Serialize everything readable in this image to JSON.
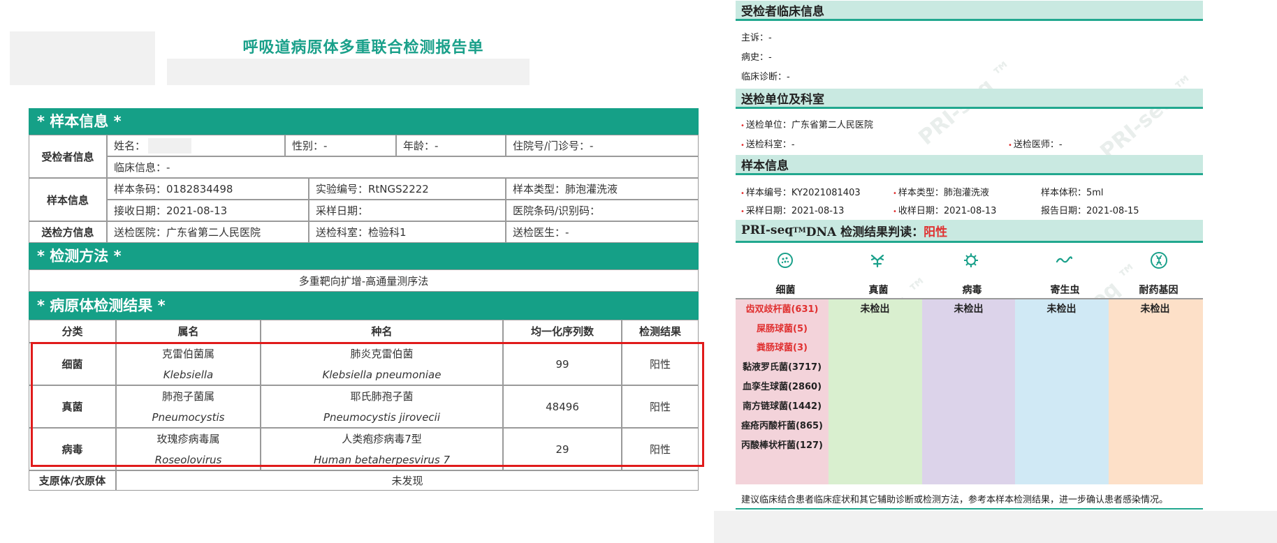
{
  "report": {
    "title": "呼吸道病原体多重联合检测报告单",
    "sections": {
      "sample_info": "* 样本信息 *",
      "method": "* 检测方法 *",
      "results": "* 病原体检测结果 *"
    },
    "patient": {
      "group_label": "受检者信息",
      "name_label": "姓名：",
      "gender": "性别：-",
      "age": "年龄：-",
      "hospital_no": "住院号/门诊号：-",
      "clinical": "临床信息：-"
    },
    "sample": {
      "group_label": "样本信息",
      "barcode": "样本条码：0182834498",
      "lab_no": "实验编号：RtNGS2222",
      "type": "样本类型：肺泡灌洗液",
      "received": "接收日期：2021-08-13",
      "collected": "采样日期：",
      "hospital_barcode": "医院条码/识别码："
    },
    "sender": {
      "group_label": "送检方信息",
      "hospital": "送检医院：广东省第二人民医院",
      "dept": "送检科室：检验科1",
      "doctor": "送检医生：-"
    },
    "method_text": "多重靶向扩增-高通量测序法",
    "results_table": {
      "headers": [
        "分类",
        "属名",
        "种名",
        "均一化序列数",
        "检测结果"
      ],
      "rows": [
        {
          "category": "细菌",
          "genus_cn": "克雷伯菌属",
          "genus_latin": "Klebsiella",
          "species_cn": "肺炎克雷伯菌",
          "species_latin": "Klebsiella pneumoniae",
          "reads": "99",
          "result": "阳性"
        },
        {
          "category": "真菌",
          "genus_cn": "肺孢子菌属",
          "genus_latin": "Pneumocystis",
          "species_cn": "耶氏肺孢子菌",
          "species_latin": "Pneumocystis jirovecii",
          "reads": "48496",
          "result": "阳性"
        },
        {
          "category": "病毒",
          "genus_cn": "玫瑰疹病毒属",
          "genus_latin": "Roseolovirus",
          "species_cn": "人类疱疹病毒7型",
          "species_latin": "Human betaherpesvirus 7",
          "reads": "29",
          "result": "阳性"
        }
      ],
      "footer_label": "支原体/衣原体",
      "footer_value": "未发现"
    }
  },
  "summary": {
    "clinical_head": "受检者临床信息",
    "complaint": "主诉：-",
    "history": "病史：-",
    "diagnosis": "临床诊断：-",
    "sender_head": "送检单位及科室",
    "sender_unit": "送检单位：广东省第二人民医院",
    "sender_dept": "送检科室：-",
    "sender_doctor": "送检医师：-",
    "sample_head": "样本信息",
    "sample_no": "样本编号：KY2021081403",
    "sample_type": "样本类型：肺泡灌洗液",
    "sample_volume": "样本体积：5ml",
    "collect_date": "采样日期：2021-08-13",
    "receive_date": "收样日期：2021-08-13",
    "report_date": "报告日期：2021-08-15",
    "result_head_a": "PRI-seq",
    "result_head_tm": "TM",
    "result_head_b": " DNA 检测结果判读：",
    "result_value": "阳性",
    "categories": [
      {
        "label": "细菌",
        "icon": "bacteria-icon",
        "color": "#f3d3da"
      },
      {
        "label": "真菌",
        "icon": "fungus-icon",
        "color": "#d9efcf"
      },
      {
        "label": "病毒",
        "icon": "virus-icon",
        "color": "#dcd3ea"
      },
      {
        "label": "寄生虫",
        "icon": "parasite-icon",
        "color": "#d0e9f5"
      },
      {
        "label": "耐药基因",
        "icon": "dna-icon",
        "color": "#fde0c8"
      }
    ],
    "bacteria": [
      {
        "name": "齿双歧杆菌(631)",
        "highlight": true
      },
      {
        "name": "屎肠球菌(5)",
        "highlight": true
      },
      {
        "name": "粪肠球菌(3)",
        "highlight": true
      },
      {
        "name": "黏液罗氏菌(3717)",
        "highlight": false
      },
      {
        "name": "血孪生球菌(2860)",
        "highlight": false
      },
      {
        "name": "南方链球菌(1442)",
        "highlight": false
      },
      {
        "name": "痤疮丙酸杆菌(865)",
        "highlight": false
      },
      {
        "name": "丙酸棒状杆菌(127)",
        "highlight": false
      }
    ],
    "not_detected": "未检出",
    "footnote": "建议临床结合患者临床症状和其它辅助诊断或检测方法，参考本样本检测结果，进一步确认患者感染情况。",
    "watermark": "PRI-seq ™"
  },
  "colors": {
    "teal": "#15a087",
    "red": "#e03030",
    "box": "#e01b1b"
  }
}
